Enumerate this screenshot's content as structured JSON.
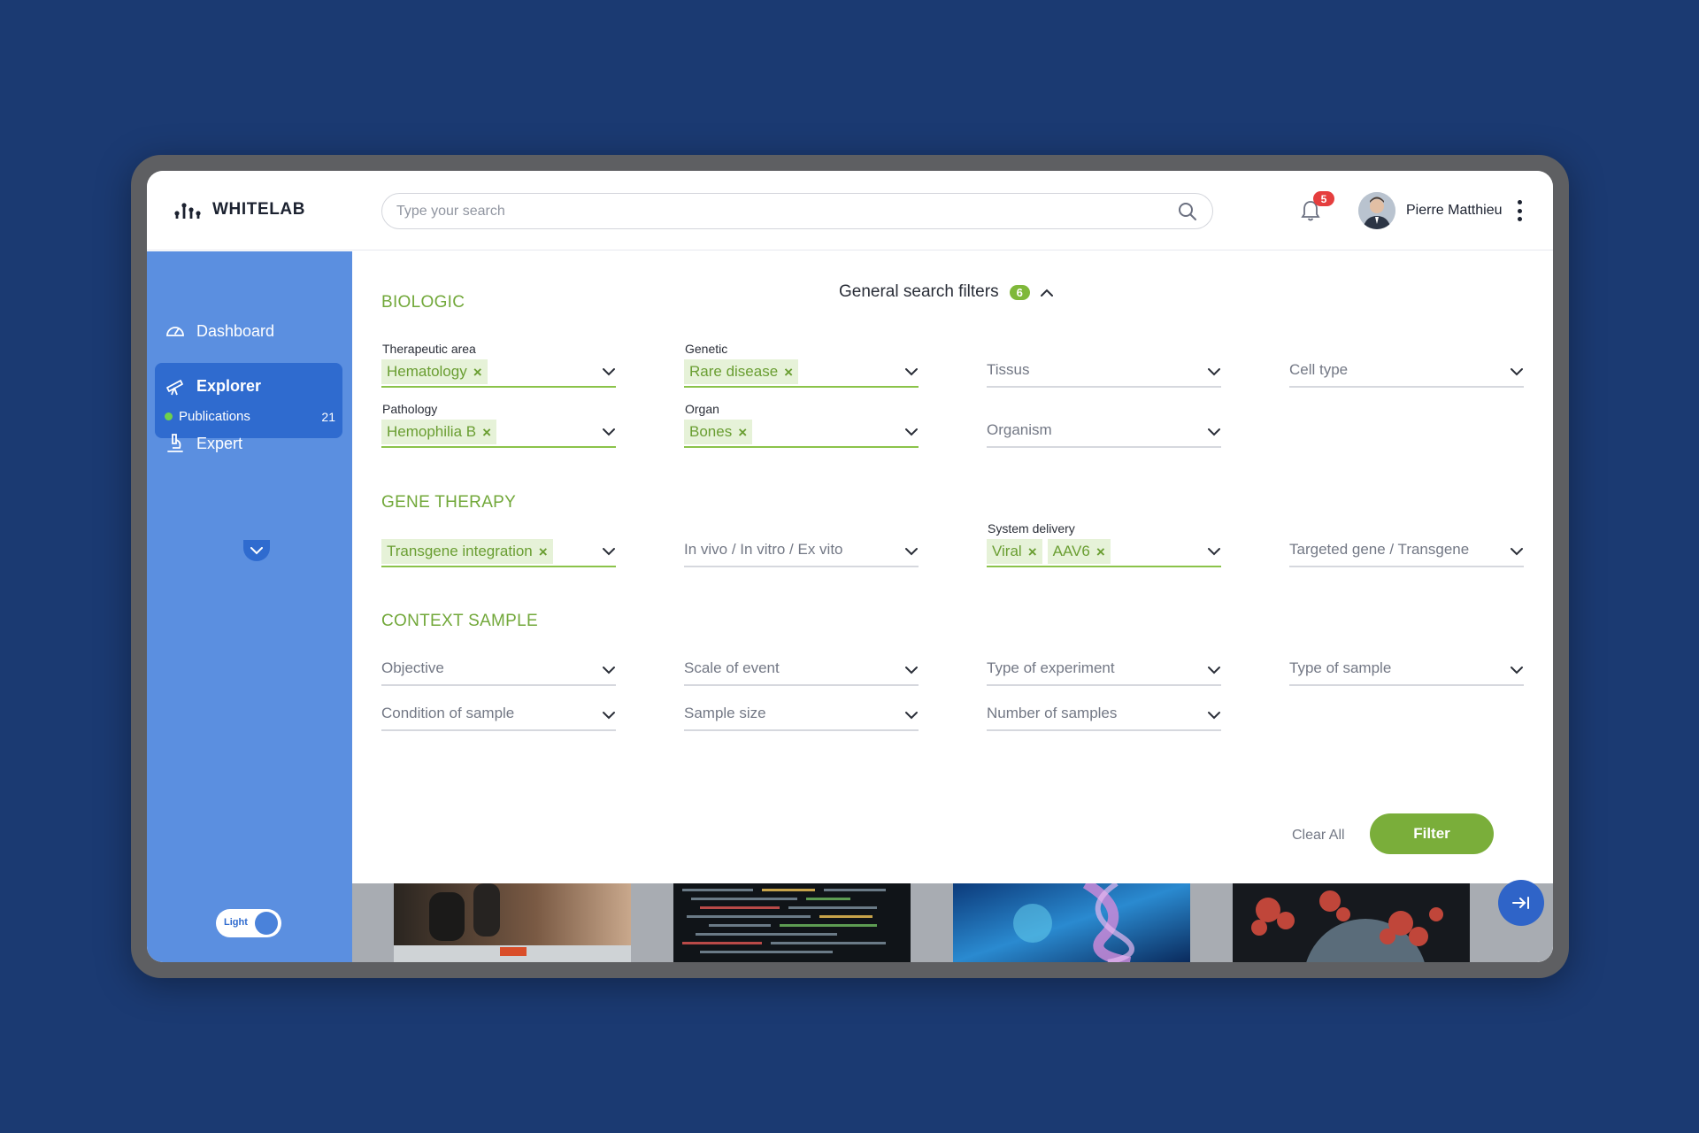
{
  "app": {
    "brand": "WHITELAB"
  },
  "search": {
    "placeholder": "Type your search"
  },
  "notifications": {
    "count": "5"
  },
  "user": {
    "name": "Pierre Matthieu"
  },
  "sidebar": {
    "dashboard_label": "Dashboard",
    "explorer_label": "Explorer",
    "publications_label": "Publications",
    "publications_count": "21",
    "expert_label": "Expert",
    "theme_label": "Light"
  },
  "filters": {
    "title": "General search filters",
    "active_count": "6",
    "sections": {
      "biologic": "BIOLOGIC",
      "gene_therapy": "GENE THERAPY",
      "context_sample": "CONTEXT SAMPLE"
    },
    "therapeutic_area": {
      "label": "Therapeutic area",
      "tags": [
        "Hematology"
      ]
    },
    "genetic": {
      "label": "Genetic",
      "tags": [
        "Rare disease"
      ]
    },
    "tissus": {
      "placeholder": "Tissus"
    },
    "cell_type": {
      "placeholder": "Cell type"
    },
    "pathology": {
      "label": "Pathology",
      "tags": [
        "Hemophilia B"
      ]
    },
    "organ": {
      "label": "Organ",
      "tags": [
        "Bones"
      ]
    },
    "organism": {
      "placeholder": "Organism"
    },
    "transgene_integration": {
      "tags": [
        "Transgene integration"
      ]
    },
    "in_vivo": {
      "placeholder": "In vivo / In vitro / Ex vito"
    },
    "system_delivery": {
      "label": "System delivery",
      "tags": [
        "Viral",
        "AAV6"
      ]
    },
    "targeted_gene": {
      "placeholder": "Targeted gene / Transgene"
    },
    "objective": {
      "placeholder": "Objective"
    },
    "scale_of_event": {
      "placeholder": "Scale of event"
    },
    "type_of_experiment": {
      "placeholder": "Type of experiment"
    },
    "type_of_sample": {
      "placeholder": "Type of sample"
    },
    "condition_of_sample": {
      "placeholder": "Condition of sample"
    },
    "sample_size": {
      "placeholder": "Sample size"
    },
    "number_of_samples": {
      "placeholder": "Number of samples"
    },
    "clear_all_label": "Clear All",
    "filter_button_label": "Filter"
  },
  "colors": {
    "page_bg": "#1b3a72",
    "sidebar_bg": "#5b8fe0",
    "sidebar_active": "#2f6bcf",
    "accent_green": "#7aae3a",
    "tag_bg": "#e6f2d8",
    "badge_red": "#e53e3e"
  },
  "thumbnails": [
    "microscope-image",
    "code-screen-image",
    "dna-helix-image",
    "virus-particle-image"
  ]
}
